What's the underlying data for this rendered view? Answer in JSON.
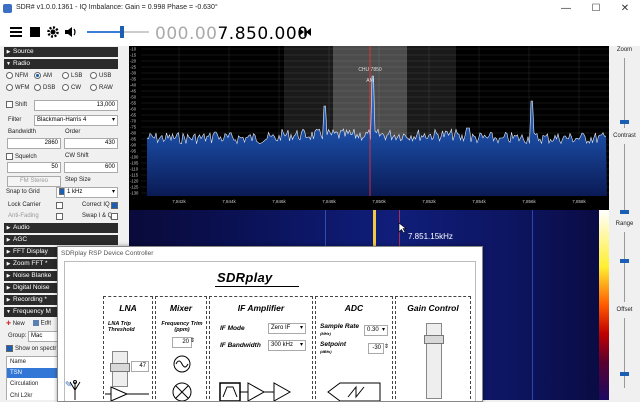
{
  "window": {
    "title": "SDR# v1.0.0.1361 - IQ Imbalance: Gain = 0.998 Phase = -0.630°",
    "minimize": "—",
    "maximize": "☐",
    "close": "✕"
  },
  "toolbar": {
    "freq_dim": "000.00",
    "freq_main": "7.850.000"
  },
  "panel": {
    "sections": {
      "source": "Source",
      "radio": "Radio",
      "audio": "Audio",
      "agc": "AGC",
      "fft": "FFT Display",
      "zoom": "Zoom FFT *",
      "noise": "Noise Blanke",
      "digital": "Digital Noise",
      "recording": "Recording *",
      "freqman": "Frequency M"
    },
    "modes": [
      {
        "label": "NFM",
        "on": false
      },
      {
        "label": "AM",
        "on": true
      },
      {
        "label": "LSB",
        "on": false
      },
      {
        "label": "USB",
        "on": false
      },
      {
        "label": "WFM",
        "on": false
      },
      {
        "label": "DSB",
        "on": false
      },
      {
        "label": "CW",
        "on": false
      },
      {
        "label": "RAW",
        "on": false
      }
    ],
    "shift_label": "Shift",
    "shift_value": "13,000",
    "filter_label": "Filter",
    "filter_value": "Blackman-Harris 4",
    "bandwidth_label": "Bandwidth",
    "bandwidth_value": "2860",
    "order_label": "Order",
    "order_value": "430",
    "squelch_label": "Squelch",
    "squelch_value": "50",
    "cwshift_label": "CW Shift",
    "cwshift_value": "600",
    "fmstereo_label": "FM Stereo",
    "stepsize_label": "Step Size",
    "snap_label": "Snap to Grid",
    "snap_value": "1 kHz",
    "lockcarrier_label": "Lock Carrier",
    "correctiq_label": "Correct IQ",
    "antifading_label": "Anti-Fading",
    "swapiq_label": "Swap I & Q",
    "fm_new": "New",
    "fm_edit": "Edit",
    "fm_group_label": "Group:",
    "fm_group_value": "Mac",
    "fm_show_label": "Show on spectr",
    "fm_col_name": "Name",
    "fm_rows": [
      "TSN",
      "Circulation",
      "Chl L2kr"
    ]
  },
  "spectrum": {
    "db_ticks": [
      "-10",
      "-15",
      "-20",
      "-25",
      "-30",
      "-35",
      "-40",
      "-45",
      "-50",
      "-55",
      "-60",
      "-65",
      "-70",
      "-75",
      "-80",
      "-85",
      "-90",
      "-95",
      "-100",
      "-105",
      "-110",
      "-115",
      "-120",
      "-125",
      "-130"
    ],
    "freq_ticks": [
      "7,842k",
      "7,844k",
      "7,846k",
      "7,848k",
      "7,850k",
      "7,852k",
      "7,854k",
      "7,856k",
      "7,858k"
    ],
    "channel_label": "CHU 7850",
    "mode_label": "AM"
  },
  "waterfall": {
    "cursor_freq": "7.851.15kHz"
  },
  "right": {
    "zoom": "Zoom",
    "contrast": "Contrast",
    "range": "Range",
    "offset": "Offset"
  },
  "dialog": {
    "title": "SDRplay RSP Device Controller",
    "logo": "SDRplay",
    "lna_title": "LNA",
    "lna_trip": "LNA Trip Threshold",
    "lna_value": "47",
    "mixer_title": "Mixer",
    "mixer_trim": "Frequency Trim (ppm)",
    "mixer_value": "20",
    "if_title": "IF Amplifier",
    "if_mode_label": "IF Mode",
    "if_mode_value": "Zero IF",
    "if_bw_label": "IF Bandwidth",
    "if_bw_value": "300 kHz",
    "adc_title": "ADC",
    "adc_rate_label": "Sample Rate",
    "adc_rate_unit": "(MHz)",
    "adc_rate_value": "0.30",
    "adc_set_label": "Setpoint",
    "adc_set_unit": "(dBfs)",
    "adc_set_value": "-30",
    "gain_title": "Gain Control"
  }
}
